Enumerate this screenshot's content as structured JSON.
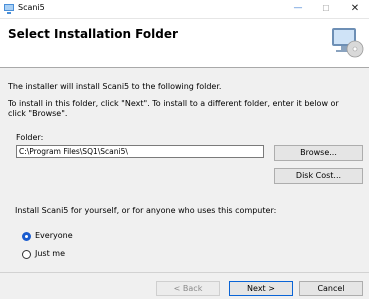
{
  "window": {
    "title": "Scani5",
    "minimize_glyph": "—",
    "maximize_glyph": "☐",
    "close_glyph": "✕"
  },
  "header": {
    "heading": "Select Installation Folder",
    "icon": "installer-computer-icon"
  },
  "body": {
    "intro": "The installer will install Scani5 to the following folder.",
    "instructions": "To install in this folder, click \"Next\". To install to a different folder, enter it below or click \"Browse\".",
    "folder_label": "Folder:",
    "folder_value": "C:\\Program Files\\SQ1\\Scani5\\",
    "browse_label": "Browse...",
    "disk_cost_label": "Disk Cost...",
    "install_for": "Install Scani5 for yourself, or for anyone who uses this computer:",
    "radio_options": [
      {
        "label": "Everyone",
        "selected": true
      },
      {
        "label": "Just me",
        "selected": false
      }
    ]
  },
  "footer": {
    "back_label": "< Back",
    "next_label": "Next >",
    "cancel_label": "Cancel"
  },
  "colors": {
    "accent": "#1a5ccf",
    "default_button_border": "#0a64d6",
    "dialog_bg": "#f0f0f0"
  }
}
